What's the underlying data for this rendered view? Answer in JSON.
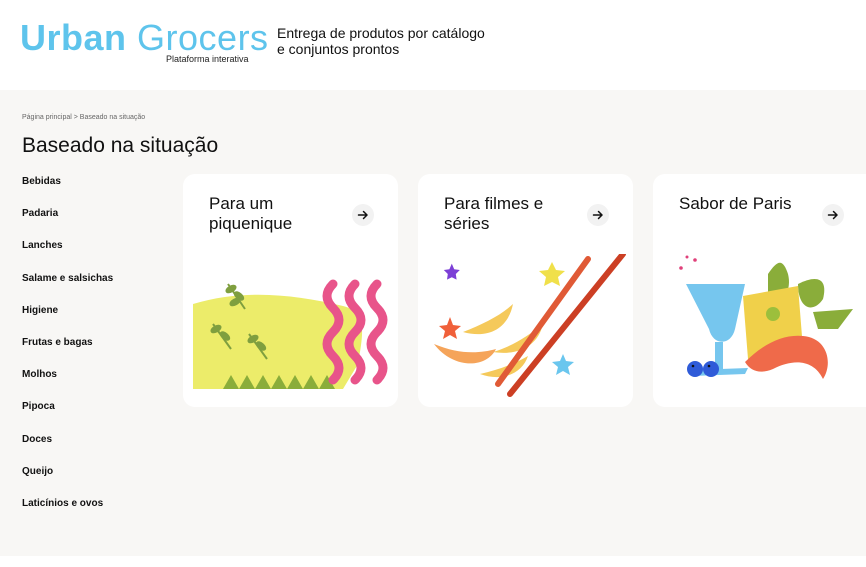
{
  "header": {
    "logo_bold": "Urban",
    "logo_light": "Grocers",
    "logo_sub": "Plataforma interativa",
    "tagline_line1": "Entrega de produtos por catálogo",
    "tagline_line2": "e conjuntos prontos"
  },
  "breadcrumb": "Página principal > Baseado na situação",
  "page_title": "Baseado na situação",
  "sidebar": {
    "items": [
      {
        "label": "Bebidas"
      },
      {
        "label": "Padaria"
      },
      {
        "label": "Lanches"
      },
      {
        "label": "Salame e salsichas"
      },
      {
        "label": "Higiene"
      },
      {
        "label": "Frutas e bagas"
      },
      {
        "label": "Molhos"
      },
      {
        "label": "Pipoca"
      },
      {
        "label": "Doces"
      },
      {
        "label": "Queijo"
      },
      {
        "label": "Laticínios e ovos"
      }
    ]
  },
  "cards": [
    {
      "line1": "Para um",
      "line2": "piquenique",
      "icon": "arrow-right-icon"
    },
    {
      "line1": "Para filmes e",
      "line2": "séries",
      "icon": "arrow-right-icon"
    },
    {
      "line1": "Sabor de Paris",
      "line2": "",
      "icon": "arrow-right-icon"
    }
  ],
  "colors": {
    "brand": "#5ec4ec",
    "background": "#f8f7f5",
    "card": "#ffffff"
  }
}
